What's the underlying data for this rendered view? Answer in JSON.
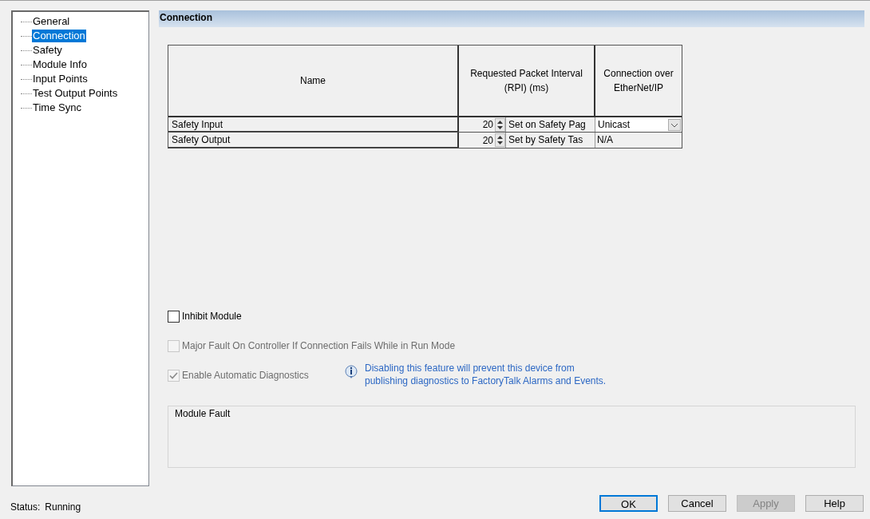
{
  "sidebar": {
    "items": [
      {
        "label": "General",
        "selected": false
      },
      {
        "label": "Connection",
        "selected": true
      },
      {
        "label": "Safety",
        "selected": false
      },
      {
        "label": "Module Info",
        "selected": false
      },
      {
        "label": "Input Points",
        "selected": false
      },
      {
        "label": "Test Output Points",
        "selected": false
      },
      {
        "label": "Time Sync",
        "selected": false
      }
    ]
  },
  "section_title": "Connection",
  "table": {
    "columns": [
      "Name",
      "Requested Packet Interval (RPI) (ms)",
      "Connection over EtherNet/IP"
    ],
    "rows": [
      {
        "name": "Safety Input",
        "rpi": "20",
        "rpi_note": "Set on Safety Pag",
        "connection": {
          "kind": "dropdown",
          "value": "Unicast"
        }
      },
      {
        "name": "Safety Output",
        "rpi": "20",
        "rpi_note": "Set by Safety Tas",
        "connection": {
          "kind": "text",
          "value": "N/A"
        }
      }
    ]
  },
  "options": [
    {
      "label": "Inhibit Module",
      "checked": false,
      "disabled": false
    },
    {
      "label": "Major Fault On Controller If Connection Fails While in Run Mode",
      "checked": false,
      "disabled": true
    },
    {
      "label": "Enable Automatic Diagnostics",
      "checked": true,
      "disabled": true
    }
  ],
  "info_note": "Disabling this feature will prevent this device from publishing diagnostics to FactoryTalk Alarms and Events.",
  "module_fault": {
    "title": "Module Fault"
  },
  "status": {
    "label": "Status:",
    "value": "Running"
  },
  "buttons": [
    {
      "label": "OK",
      "default": true,
      "disabled": false
    },
    {
      "label": "Cancel",
      "default": false,
      "disabled": false
    },
    {
      "label": "Apply",
      "default": false,
      "disabled": true
    },
    {
      "label": "Help",
      "default": false,
      "disabled": false
    }
  ]
}
